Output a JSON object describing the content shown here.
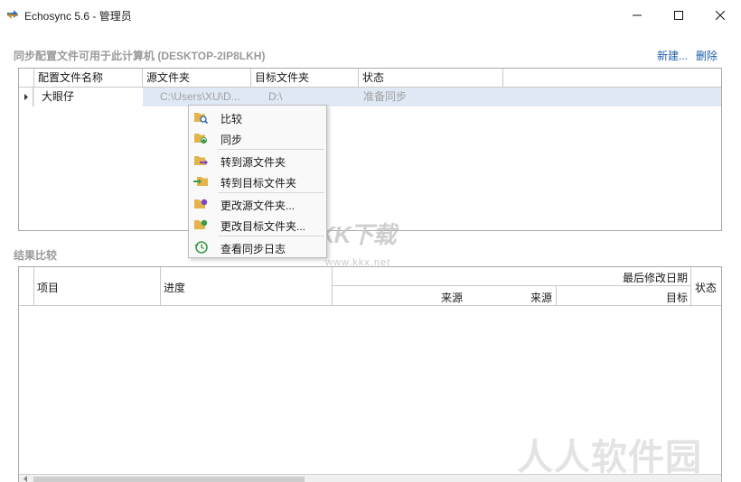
{
  "window": {
    "title": "Echosync 5.6 - 管理员",
    "icon": "sync-arrows-icon"
  },
  "profiles_section": {
    "title": "同步配置文件可用于此计算机 (DESKTOP-2IP8LKH)",
    "new_link": "新建...",
    "delete_link": "删除",
    "columns": [
      "配置文件名称",
      "源文件夹",
      "目标文件夹",
      "状态"
    ],
    "rows": [
      {
        "name": "大眼仔",
        "source": "C:\\Users\\XU\\D...",
        "target": "D:\\",
        "status": "准备同步"
      }
    ]
  },
  "context_menu": {
    "items": [
      {
        "label": "比较",
        "icon": "folder-magnifier-icon"
      },
      {
        "label": "同步",
        "icon": "folder-sync-icon"
      },
      {
        "label": "转到源文件夹",
        "icon": "folder-arrow-icon"
      },
      {
        "label": "转到目标文件夹",
        "icon": "folder-arrow-in-icon"
      },
      {
        "label": "更改源文件夹...",
        "icon": "folder-edit-icon"
      },
      {
        "label": "更改目标文件夹...",
        "icon": "folder-edit-target-icon"
      },
      {
        "label": "查看同步日志",
        "icon": "history-icon"
      }
    ]
  },
  "results_section": {
    "title": "结果比较",
    "col_item": "项目",
    "col_progress": "进度",
    "col_last_modified": "最后修改日期",
    "col_source1": "来源",
    "col_source2": "来源",
    "col_target": "目标",
    "col_status": "状态"
  },
  "watermarks": {
    "kk": "KK下载",
    "kk_url": "www.kkx.net",
    "site": "人人软件园"
  },
  "colors": {
    "selection": "#dfe9f5",
    "link": "#1f5fa8",
    "heading": "#9a9a9a"
  }
}
